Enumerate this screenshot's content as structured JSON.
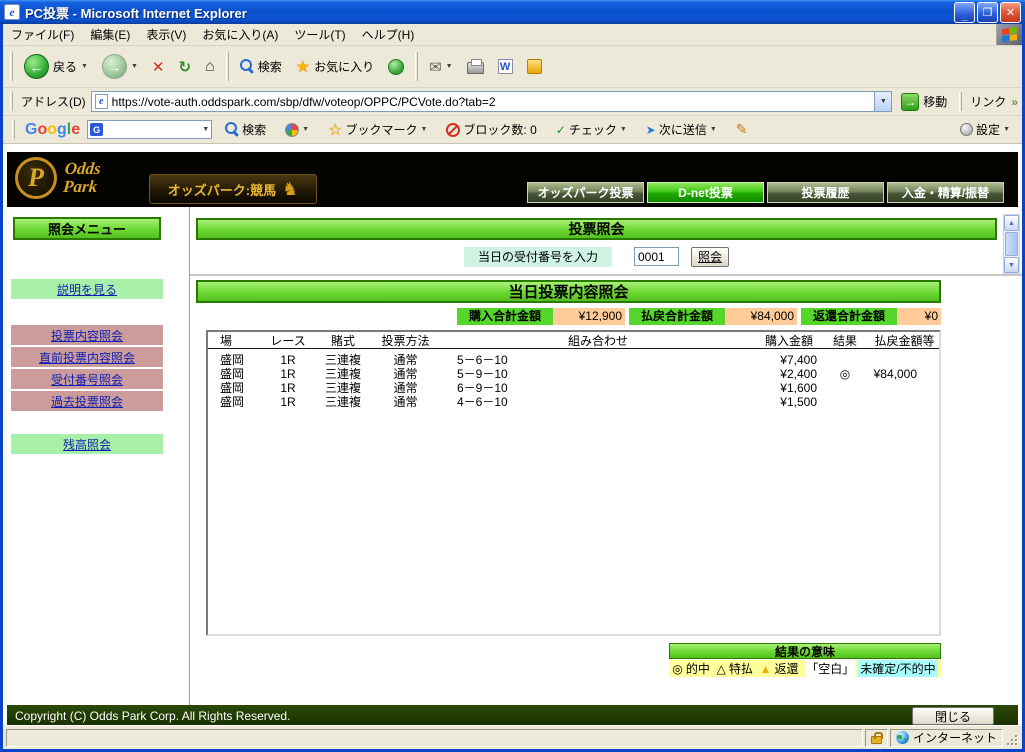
{
  "window": {
    "title": "PC投票 - Microsoft Internet Explorer"
  },
  "menubar": {
    "items": [
      "ファイル(F)",
      "編集(E)",
      "表示(V)",
      "お気に入り(A)",
      "ツール(T)",
      "ヘルプ(H)"
    ]
  },
  "toolbar": {
    "back": "戻る",
    "search": "検索",
    "favorites": "お気に入り"
  },
  "addressbar": {
    "label": "アドレス(D)",
    "url": "https://vote-auth.oddspark.com/sbp/dfw/voteop/OPPC/PCVote.do?tab=2",
    "go": "移動",
    "links": "リンク"
  },
  "googlebar": {
    "logo_letters": [
      "G",
      "o",
      "o",
      "g",
      "l",
      "e"
    ],
    "search": "検索",
    "bookmarks": "ブックマーク",
    "blocked": "ブロック数: 0",
    "check": "チェック",
    "send": "次に送信",
    "settings": "設定"
  },
  "site_header": {
    "logo_top": "Odds",
    "logo_bottom": "Park",
    "badge": "オッズパーク:競馬",
    "nav": [
      {
        "label": "オッズパーク投票"
      },
      {
        "label": "D-net投票"
      },
      {
        "label": "投票履歴"
      },
      {
        "label": "入金・精算/振替"
      }
    ]
  },
  "sidebar": {
    "title": "照会メニュー",
    "help": "説明を見る",
    "links": [
      "投票内容照会",
      "直前投票内容照会",
      "受付番号照会",
      "過去投票照会"
    ],
    "balance": "残高照会"
  },
  "vote_inquiry": {
    "title": "投票照会",
    "input_label": "当日の受付番号を入力",
    "input_value": "0001",
    "button": "照会"
  },
  "today": {
    "title": "当日投票内容照会",
    "totals": [
      {
        "label": "購入合計金額",
        "value": "¥12,900"
      },
      {
        "label": "払戻合計金額",
        "value": "¥84,000"
      },
      {
        "label": "返還合計金額",
        "value": "¥0"
      }
    ],
    "table": {
      "headers": [
        "場",
        "レース",
        "賭式",
        "投票方法",
        "組み合わせ",
        "購入金額",
        "結果",
        "払戻金額等"
      ],
      "rows": [
        {
          "venue": "盛岡",
          "race": "1R",
          "type": "三連複",
          "method": "通常",
          "combo": "5－6－10",
          "amount": "¥7,400",
          "result": "",
          "payout": ""
        },
        {
          "venue": "盛岡",
          "race": "1R",
          "type": "三連複",
          "method": "通常",
          "combo": "5－9－10",
          "amount": "¥2,400",
          "result": "◎",
          "payout": "¥84,000"
        },
        {
          "venue": "盛岡",
          "race": "1R",
          "type": "三連複",
          "method": "通常",
          "combo": "6－9－10",
          "amount": "¥1,600",
          "result": "",
          "payout": ""
        },
        {
          "venue": "盛岡",
          "race": "1R",
          "type": "三連複",
          "method": "通常",
          "combo": "4－6－10",
          "amount": "¥1,500",
          "result": "",
          "payout": ""
        }
      ]
    },
    "legend": {
      "title": "結果の意味",
      "items": [
        {
          "symbol": "◎",
          "label": "的中"
        },
        {
          "symbol": "△",
          "label": "特払"
        },
        {
          "symbol": "▲",
          "label": "返還"
        },
        {
          "symbol": "「空白」",
          "label": "未確定/不的中"
        }
      ]
    }
  },
  "page_footer": {
    "copyright": "Copyright (C) Odds Park Corp. All Rights Reserved.",
    "close": "閉じる"
  },
  "statusbar": {
    "zone": "インターネット"
  }
}
